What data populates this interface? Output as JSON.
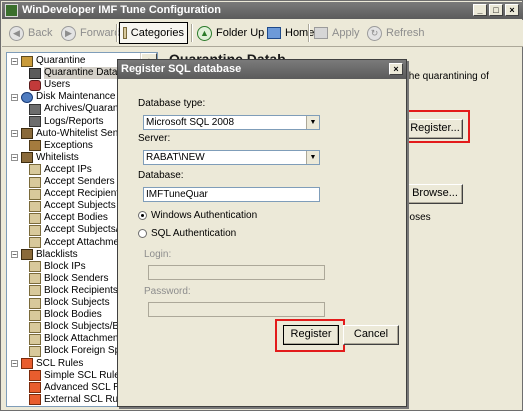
{
  "window": {
    "title": "WinDeveloper IMF Tune Configuration",
    "controls": [
      "_",
      "□",
      "×"
    ]
  },
  "toolbar": {
    "back": "Back",
    "forward": "Forward",
    "categories": "Categories",
    "folder_up": "Folder Up",
    "home": "Home",
    "apply": "Apply",
    "refresh": "Refresh"
  },
  "tree": {
    "nodes": [
      {
        "label": "Quarantine",
        "expander": "−",
        "icon": "folder-icon"
      },
      {
        "label": "Quarantine Databa",
        "icon": "database-icon",
        "selected": true
      },
      {
        "label": "Users",
        "icon": "users-icon"
      },
      {
        "label": "Disk Maintenance",
        "expander": "−",
        "icon": "disk-icon"
      },
      {
        "label": "Archives/Quarantin",
        "icon": "pencil-icon"
      },
      {
        "label": "Logs/Reports",
        "icon": "pencil-icon"
      },
      {
        "label": "Auto-Whitelist Senders",
        "expander": "−",
        "icon": "group-icon"
      },
      {
        "label": "Exceptions",
        "icon": "exclusion-icon"
      },
      {
        "label": "Whitelists",
        "expander": "−",
        "icon": "group-icon"
      },
      {
        "label": "Accept IPs",
        "icon": "list-icon"
      },
      {
        "label": "Accept Senders",
        "icon": "list-icon"
      },
      {
        "label": "Accept Recipients",
        "icon": "list-icon"
      },
      {
        "label": "Accept Subjects",
        "icon": "list-icon"
      },
      {
        "label": "Accept Bodies",
        "icon": "list-icon"
      },
      {
        "label": "Accept Subjects/Bo",
        "icon": "list-icon"
      },
      {
        "label": "Accept Attachmen",
        "icon": "list-icon"
      },
      {
        "label": "Blacklists",
        "expander": "−",
        "icon": "group-icon"
      },
      {
        "label": "Block IPs",
        "icon": "list-icon"
      },
      {
        "label": "Block Senders",
        "icon": "list-icon"
      },
      {
        "label": "Block Recipients",
        "icon": "list-icon"
      },
      {
        "label": "Block Subjects",
        "icon": "list-icon"
      },
      {
        "label": "Block Bodies",
        "icon": "list-icon"
      },
      {
        "label": "Block Subjects/Bo",
        "icon": "list-icon"
      },
      {
        "label": "Block Attachments",
        "icon": "list-icon"
      },
      {
        "label": "Block Foreign Spa",
        "icon": "list-icon"
      },
      {
        "label": "SCL Rules",
        "expander": "−",
        "icon": "scl-icon"
      },
      {
        "label": "Simple SCL Rules",
        "icon": "scl-icon"
      },
      {
        "label": "Advanced SCL Rules",
        "icon": "scl-icon"
      },
      {
        "label": "External SCL Rules",
        "icon": "scl-icon"
      }
    ]
  },
  "right_panel": {
    "heading_fragment": "Quarantine Datab",
    "text_fragment": "the quarantining of",
    "register_button": "Register...",
    "browse_button": "Browse...",
    "purposes_fragment": "poses"
  },
  "dialog": {
    "title": "Register SQL database",
    "close": "×",
    "db_type_label": "Database type:",
    "db_type_value": "Microsoft SQL 2008",
    "server_label": "Server:",
    "server_value": "RABAT\\NEW",
    "database_label": "Database:",
    "database_value": "IMFTuneQuar",
    "auth_windows": "Windows Authentication",
    "auth_sql": "SQL Authentication",
    "login_label": "Login:",
    "login_value": "",
    "password_label": "Password:",
    "password_value": "",
    "register_button": "Register",
    "cancel_button": "Cancel"
  },
  "colors": {
    "highlight": "#e31b1b",
    "chrome": "#ece9d8",
    "titlebar": "#5b5b5b"
  }
}
